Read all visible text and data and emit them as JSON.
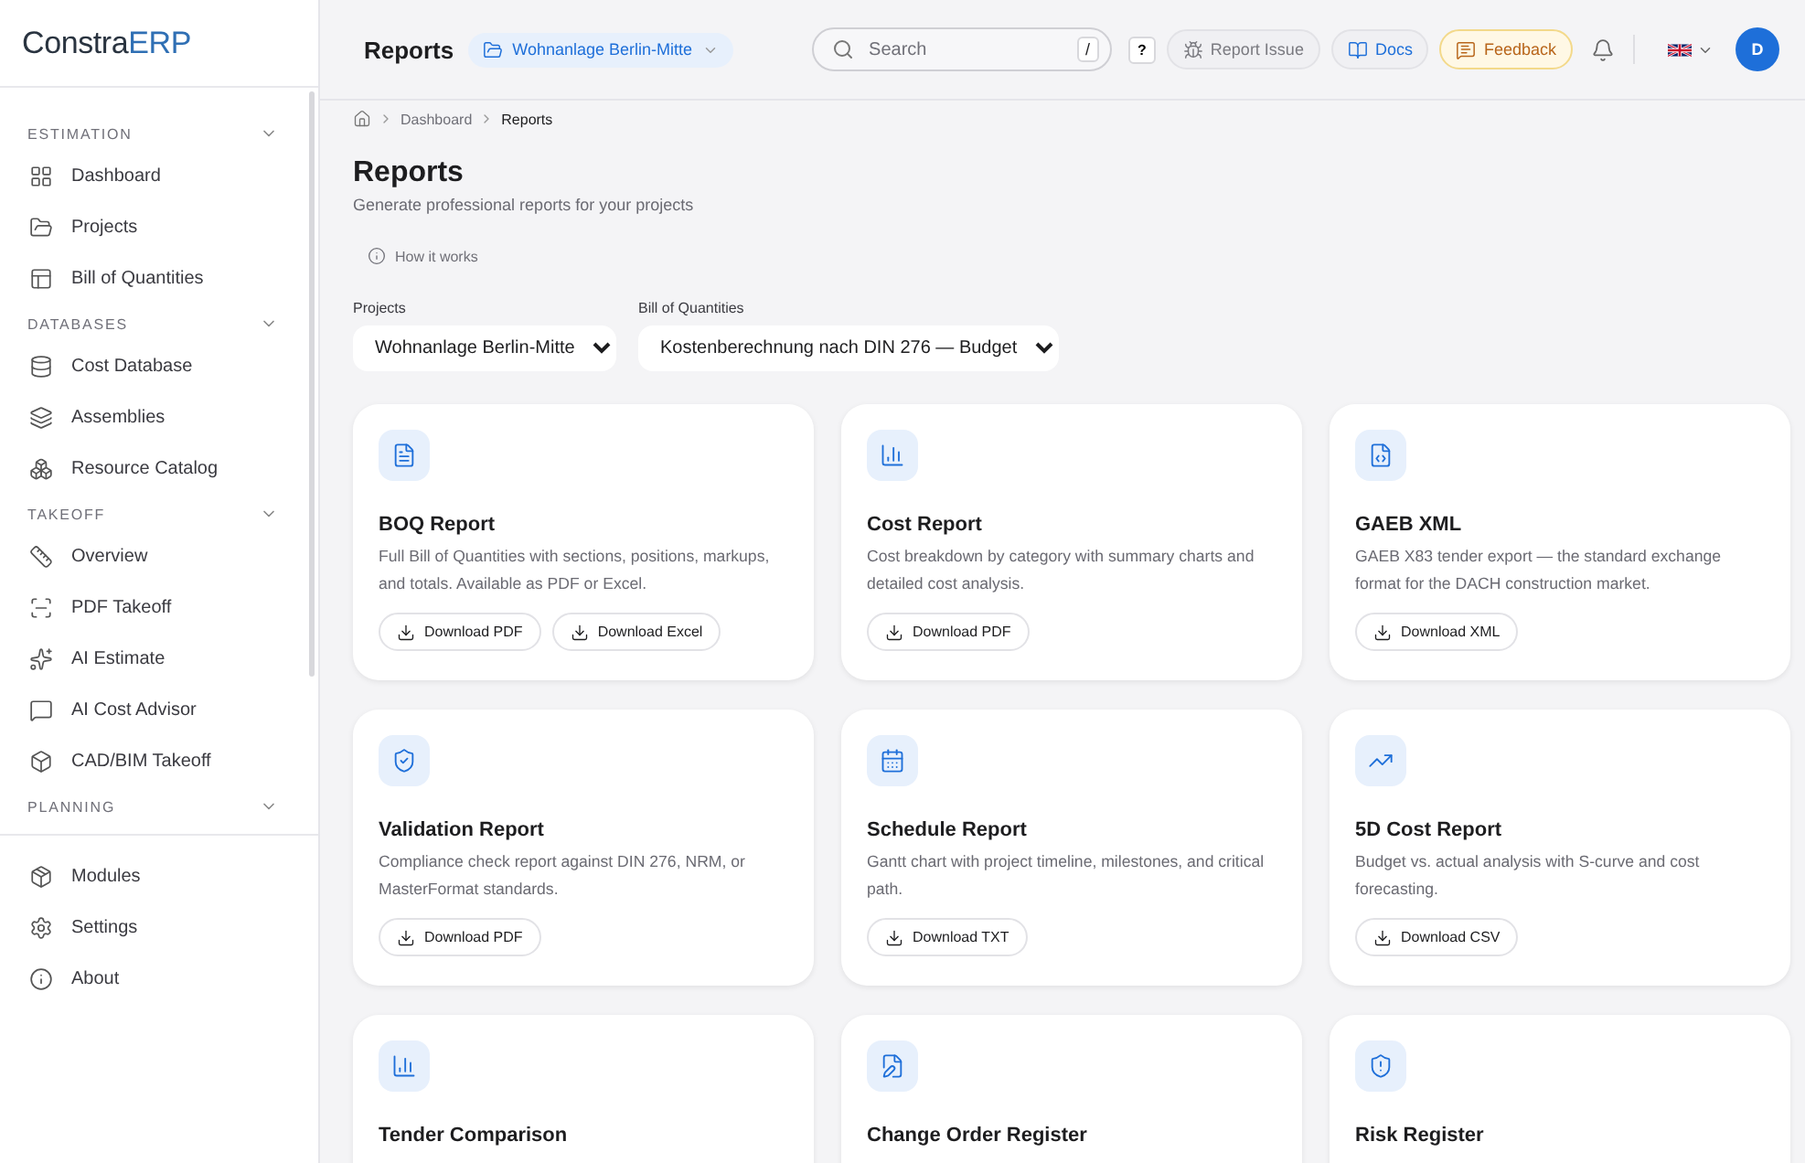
{
  "logo": {
    "name": "Constra",
    "accent": "ERP"
  },
  "sidebar": {
    "sections": [
      {
        "title": "ESTIMATION",
        "items": [
          "Dashboard",
          "Projects",
          "Bill of Quantities"
        ]
      },
      {
        "title": "DATABASES",
        "items": [
          "Cost Database",
          "Assemblies",
          "Resource Catalog"
        ]
      },
      {
        "title": "TAKEOFF",
        "items": [
          "Overview",
          "PDF Takeoff",
          "AI Estimate",
          "AI Cost Advisor",
          "CAD/BIM Takeoff"
        ]
      },
      {
        "title": "PLANNING"
      }
    ],
    "footer_items": [
      "Modules",
      "Settings",
      "About"
    ]
  },
  "header": {
    "title": "Reports",
    "project_chip": "Wohnanlage Berlin-Mitte",
    "search": {
      "placeholder": "Search",
      "shortcut": "/"
    },
    "help": "?",
    "report_issue": "Report Issue",
    "docs": "Docs",
    "feedback": "Feedback",
    "avatar": "D"
  },
  "breadcrumb": [
    "Dashboard",
    "Reports"
  ],
  "page": {
    "title": "Reports",
    "subtitle": "Generate professional reports for your projects",
    "how_it_works": "How it works"
  },
  "filters": [
    {
      "label": "Projects",
      "value": "Wohnanlage Berlin-Mitte"
    },
    {
      "label": "Bill of Quantities",
      "value": "Kostenberechnung nach DIN 276 — Budget"
    }
  ],
  "cards": [
    {
      "title": "BOQ Report",
      "description": "Full Bill of Quantities with sections, positions, markups, and totals. Available as PDF or Excel.",
      "buttons": [
        "Download PDF",
        "Download Excel"
      ]
    },
    {
      "title": "Cost Report",
      "description": "Cost breakdown by category with summary charts and detailed cost analysis.",
      "buttons": [
        "Download PDF"
      ]
    },
    {
      "title": "GAEB XML",
      "description": "GAEB X83 tender export — the standard exchange format for the DACH construction market.",
      "buttons": [
        "Download XML"
      ]
    },
    {
      "title": "Validation Report",
      "description": "Compliance check report against DIN 276, NRM, or MasterFormat standards.",
      "buttons": [
        "Download PDF"
      ]
    },
    {
      "title": "Schedule Report",
      "description": "Gantt chart with project timeline, milestones, and critical path.",
      "buttons": [
        "Download TXT"
      ]
    },
    {
      "title": "5D Cost Report",
      "description": "Budget vs. actual analysis with S-curve and cost forecasting.",
      "buttons": [
        "Download CSV"
      ]
    },
    {
      "title": "Tender Comparison"
    },
    {
      "title": "Change Order Register"
    },
    {
      "title": "Risk Register"
    }
  ]
}
